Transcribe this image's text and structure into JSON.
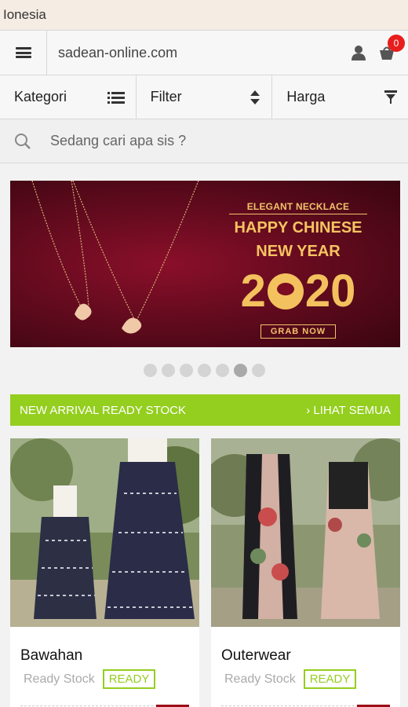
{
  "topbar": {
    "text": "Ionesia"
  },
  "header": {
    "site": "sadean-online.com",
    "cart_count": "0"
  },
  "filters": {
    "kategori": "Kategori",
    "filter": "Filter",
    "harga": "Harga"
  },
  "search": {
    "placeholder": "Sedang cari apa sis ?"
  },
  "banner": {
    "tag": "ELEGANT NECKLACE",
    "headline1": "HAPPY CHINESE",
    "headline2": "NEW YEAR",
    "year_left": "2",
    "year_right": "20",
    "cta": "GRAB NOW"
  },
  "carousel": {
    "total": 7,
    "active_index": 5
  },
  "section": {
    "title": "NEW ARRIVAL READY STOCK",
    "link": "› LIHAT SEMUA"
  },
  "products": [
    {
      "name": "Bawahan",
      "stock": "Ready Stock",
      "badge": "READY"
    },
    {
      "name": "Outerwear",
      "stock": "Ready Stock",
      "badge": "READY"
    }
  ],
  "colors": {
    "accent_green": "#94ce1f",
    "badge_red": "#e81d1d",
    "banner_bg": "#6b0a20",
    "gold": "#f3c15e"
  }
}
